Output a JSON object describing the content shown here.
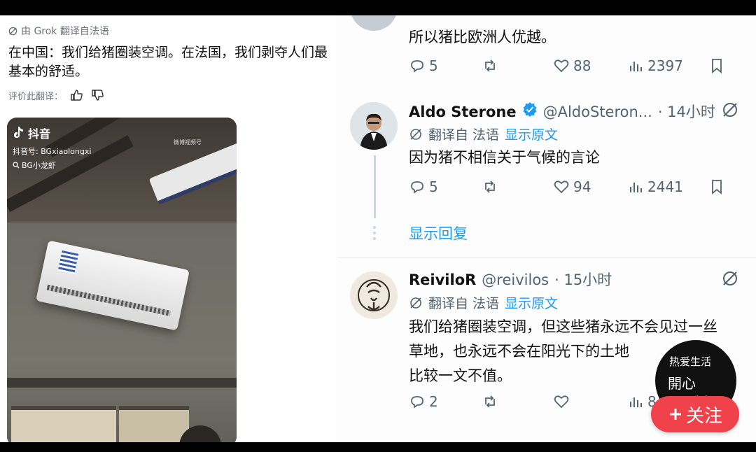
{
  "left_post": {
    "translate_note": "由 Grok 翻译自法语",
    "text": "在中国：我们给猪圈装空调。在法国，我们剥夺人们最基本的舒适。",
    "rate_label": "评价此翻译："
  },
  "video": {
    "app_name": "抖音",
    "account_id": "抖音号: BGxiaolongxi",
    "search_text": "BG小龙虾",
    "watermark": "微博视频号"
  },
  "tweets": [
    {
      "body": "所以猪比欧洲人优越。",
      "replies": "5",
      "likes": "88",
      "views": "2397"
    },
    {
      "name": "Aldo Sterone",
      "verified": true,
      "handle": "@AldoSteron...",
      "time": "· 14小时",
      "translated_from": "翻译自 法语",
      "show_original": "显示原文",
      "body": "因为猪不相信关于气候的言论",
      "replies": "5",
      "likes": "94",
      "views": "2441"
    },
    {
      "name": "ReiviloR",
      "handle": "@reivilos",
      "time": "· 15小时",
      "translated_from": "翻译自 法语",
      "show_original": "显示原文",
      "body_lines": [
        "我们给猪圈装空调，但这些猪永远不会见过一丝",
        "草地，也永远不会在阳光下的土地",
        "比较一文不值。"
      ],
      "replies": "2",
      "views_partial": "8"
    }
  ],
  "show_replies": "显示回复",
  "follow": {
    "label": "关注",
    "avatar_text": [
      "热爱生活",
      "開心",
      "有趣"
    ]
  },
  "colors": {
    "accent_blue": "#1d9bf0",
    "follow_red": "#f0424a",
    "muted": "#536471"
  }
}
